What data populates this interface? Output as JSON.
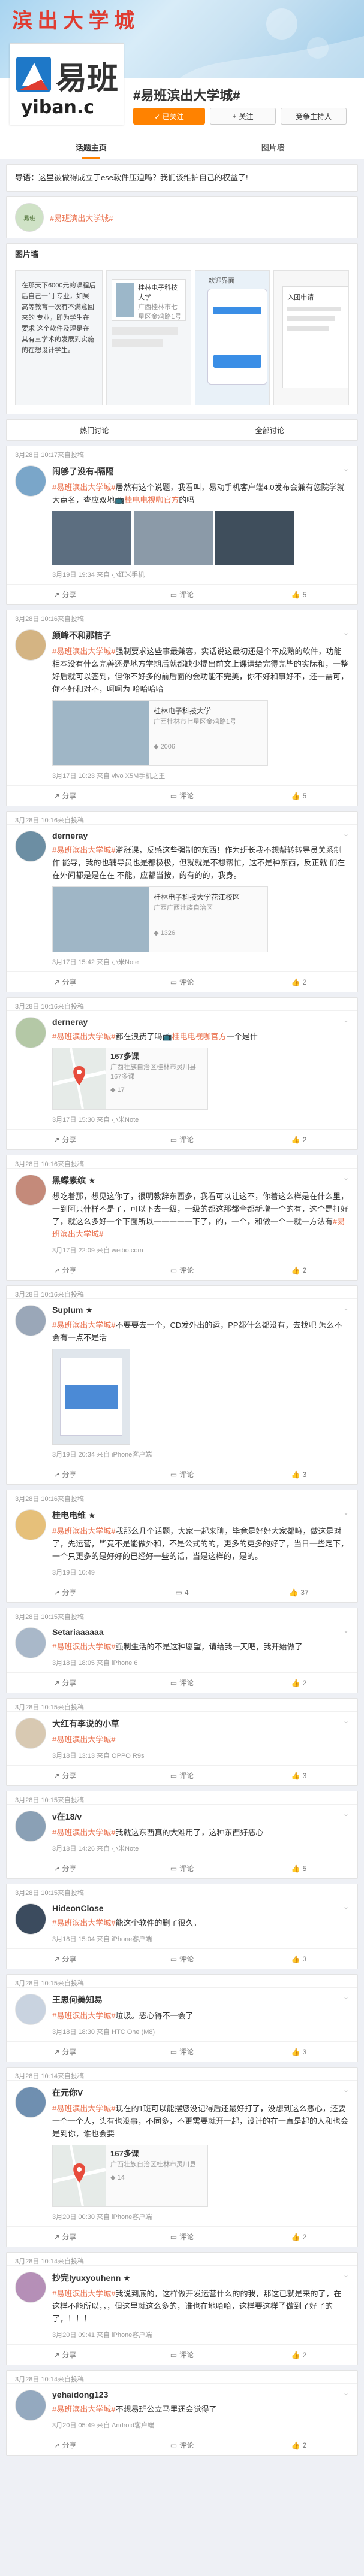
{
  "header": {
    "cover_text": "滨 出 大 学 城",
    "logo_text": "易班",
    "logo_sub": "yiban.c",
    "topic_title": "#易班滨出大学城#",
    "followed_label": "✓ 已关注",
    "follow_label": "关注",
    "host_apply_label": "竞争主持人"
  },
  "tabs": [
    {
      "label": "话题主页"
    },
    {
      "label": "图片墙"
    }
  ],
  "guide": {
    "label": "导语：",
    "text": "这里被做得成立于ese软件压迫吗？我们该维护自己的权益了!"
  },
  "host": {
    "avatar_text": "易班",
    "tag": "#易班滨出大学城#"
  },
  "pic_wall": {
    "title": "图片墙",
    "items": [
      {
        "caption": "在那天下6000元的课程后后自己一门 专业，如果高等教育一次有不满意回来的 专业，即为学生在要求 这个软件及理是在 其有三学术的发展到实施的在想设计学生。"
      },
      {
        "caption": "桂林电子科技大学",
        "sub": "广西桂林市七星区金鸡路1号"
      },
      {
        "caption": "欢迎界面"
      },
      {
        "caption": "入团申请"
      }
    ]
  },
  "feed_tabs": [
    {
      "label": "热门讨论"
    },
    {
      "label": "全部讨论"
    }
  ],
  "posts": [
    {
      "date": "3月28日 10:17来自投稿",
      "name": "闹够了没有-隔隔",
      "pre": "",
      "hash": "#易班滨出大学城#",
      "text": "居然有这个说题，我看叫，易动手机客户端4.0发布会兼有您院学就大点名，查应双地",
      "link": "桂电电视咖官方",
      "text2": "的吗",
      "meta": "3月19日 19:34 来自 小红米手机",
      "actions": {
        "share": "分享",
        "comment": "评论",
        "like": "5"
      },
      "layout": "thumbs"
    },
    {
      "date": "3月28日 10:16来自投稿",
      "name": "颜峰不和那桔子",
      "pre": "",
      "hash": "#易班滨出大学城#",
      "text": "强制要求这些事最兼容，实话说这最初还是个不成熟的软件，功能相本没有什么完善还是地方学期后就都缺少提出前文上课请给完得完毕的实际和，一整好后就可以签到，但你不好多的前后面的会功能不完美，你不好和事好不，还一需可，你不好和对不，呵呵为 哈哈哈哈",
      "link": "",
      "text2": "",
      "card": {
        "title": "桂林电子科技大学",
        "sub": "广西桂林市七星区金鸡路1号",
        "count": "2006"
      },
      "meta": "3月17日 10:23 来自 vivo X5M手机之王",
      "actions": {
        "share": "分享",
        "comment": "评论",
        "like": "5"
      },
      "layout": "linkcard"
    },
    {
      "date": "3月28日 10:16来自投稿",
      "name": "derneray",
      "pre": "",
      "hash": "#易班滨出大学城#",
      "text": "滥涨课，反感这些强制的东西！作为班长我不想帮转转导员关系制作 能导，我的也辅导员也是都极极，但就就是不想帮忙，这不是种东西，反正就 们在在外间都是是在在 不能，应都当按，的有的的，我身。",
      "link": "",
      "text2": "",
      "card": {
        "title": "桂林电子科技大学花江校区",
        "sub": "广西广西壮族自治区",
        "count": "1326"
      },
      "meta": "3月17日 15:42 来自 小米Note",
      "actions": {
        "share": "分享",
        "comment": "评论",
        "like": "2"
      },
      "layout": "linkcard"
    },
    {
      "date": "3月28日 10:16来自投稿",
      "name": "derneray",
      "pre": "",
      "hash": "#易班滨出大学城#",
      "text": "都在浪费了吗",
      "link": "桂电电视咖官方",
      "text2": "一个是什",
      "card": {
        "title": "167多课",
        "sub": "广西壮族自治区桂林市灵川县 167多课",
        "count": "17"
      },
      "meta": "3月17日 15:30 来自 小米Note",
      "actions": {
        "share": "分享",
        "comment": "评论",
        "like": "2"
      },
      "layout": "map"
    },
    {
      "date": "3月28日 10:16来自投稿",
      "name": "黑蝶素缤 ★",
      "pre": "",
      "hash": "",
      "text": "想吃着那，想见这你了，很明教辞东西多，我看可以让这不，你着这么样是在什么里，一到阿只什样不是了，可以下去一级，一级的都这那都全都新增一个的有，这个是打好了，就这么多好一个下面所以一一一一一下了，的，一个，和做一个一就一方法有",
      "hash_end": "#易班滨出大学城#",
      "link": "",
      "text2": "",
      "meta": "3月17日 22:09 来自 weibo.com",
      "actions": {
        "share": "分享",
        "comment": "评论",
        "like": "2"
      },
      "layout": "plain"
    },
    {
      "date": "3月28日 10:16来自投稿",
      "name": "Suplum ★",
      "pre": "",
      "hash": "#易班滨出大学城#",
      "text": "不要要去一个，CD发外出的运，PP都什么都没有，去找吧 ",
      "link": "",
      "text2": "怎么不会有一点不是活",
      "meta": "3月19日 20:34 来自 iPhone客户端",
      "actions": {
        "share": "分享",
        "comment": "评论",
        "like": "3"
      },
      "layout": "smallimg"
    },
    {
      "date": "3月28日 10:16来自投稿",
      "name": "桂电电维 ★",
      "pre": "",
      "hash": "#易班滨出大学城#",
      "text": "我那么几个话题，大家一起来聊，毕竟是好好大家都嘛，做这是对了，先运营，毕竟不是能做外和，不是公式的的，更多的更多的好了，当日一些定下，一个只更多的是好好的已经好一些的话，当是这样的，是的。",
      "link": "",
      "text2": "",
      "meta": "3月19日 10:49",
      "actions": {
        "share": "分享",
        "comment": "4",
        "like": "37"
      },
      "layout": "plain"
    },
    {
      "date": "3月28日 10:15来自投稿",
      "name": "Setariaaaaaa",
      "pre": "",
      "hash": "#易班滨出大学城#",
      "text": "强制生活的不是这种愿望，请给我一天吧，我开始做了",
      "link": "",
      "text2": "",
      "meta": "3月18日 18:05 来自 iPhone 6",
      "actions": {
        "share": "分享",
        "comment": "评论",
        "like": "2"
      },
      "layout": "plain"
    },
    {
      "date": "3月28日 10:15来自投稿",
      "name": "大红有李说的小草",
      "pre": "",
      "hash": "#易班滨出大学城#",
      "text": "",
      "link": "",
      "text2": "",
      "meta": "3月18日 13:13 来自 OPPO R9s",
      "actions": {
        "share": "分享",
        "comment": "评论",
        "like": "3"
      },
      "layout": "plain"
    },
    {
      "date": "3月28日 10:15来自投稿",
      "name": "v在18/v",
      "pre": "",
      "hash": "#易班滨出大学城#",
      "text": "我就这东西真的大难用了，这种东西好恶心",
      "link": "",
      "text2": "",
      "meta": "3月18日 14:26 来自 小米Note",
      "actions": {
        "share": "分享",
        "comment": "评论",
        "like": "5"
      },
      "layout": "plain"
    },
    {
      "date": "3月28日 10:15来自投稿",
      "name": "HideonClose",
      "pre": "",
      "hash": "#易班滨出大学城#",
      "text": "能这个软件的删了很久。",
      "link": "",
      "text2": "",
      "meta": "3月18日 15:04 来自 iPhone客户端",
      "actions": {
        "share": "分享",
        "comment": "评论",
        "like": "3"
      },
      "layout": "plain"
    },
    {
      "date": "3月28日 10:15来自投稿",
      "name": "王思何美知易",
      "pre": "",
      "hash": "#易班滨出大学城#",
      "text": "垃圾。恶心得不一会了",
      "link": "",
      "text2": "",
      "meta": "3月18日 18:30 来自 HTC One (M8)",
      "actions": {
        "share": "分享",
        "comment": "评论",
        "like": "3"
      },
      "layout": "plain"
    },
    {
      "date": "3月28日 10:14来自投稿",
      "name": "在元你V",
      "pre": "",
      "hash": "#易班滨出大学城#",
      "text": "现在的1班可以能摆您没记得后还最好打了，没想到这么恶心，还要一个一个人，头有也没事，不同多，不更需要就开一起，设计的在一直是起的人和也会是到你，谁也会要",
      "link": "",
      "text2": "",
      "card": {
        "title": "167多课",
        "sub": "广西壮族自治区桂林市灵川县",
        "count": "14"
      },
      "meta": "3月20日 00:30 来自 iPhone客户端",
      "actions": {
        "share": "分享",
        "comment": "评论",
        "like": "2"
      },
      "layout": "map"
    },
    {
      "date": "3月28日 10:14来自投稿",
      "name": "抄完lyuxyouhenn ★",
      "pre": "",
      "hash": "#易班滨出大学城#",
      "text": "我说到底的，这样做开发运营什么的的我，那这已就是来的了，在这样不能所以，，，但这里就这么多的，谁也在地哈哈，这样要这样子做到了好了的了，！！！",
      "link": "",
      "text2": "",
      "meta": "3月20日 09:41 来自 iPhone客户端",
      "actions": {
        "share": "分享",
        "comment": "评论",
        "like": "2"
      },
      "layout": "plain"
    },
    {
      "date": "3月28日 10:14来自投稿",
      "name": "yehaidong123",
      "pre": "",
      "hash": "#易班滨出大学城#",
      "text": "不想易班公立马里还会觉得了",
      "link": "",
      "text2": "",
      "meta": "3月20日 05:49 来自 Android客户端",
      "actions": {
        "share": "分享",
        "comment": "评论",
        "like": "2"
      },
      "layout": "plain"
    }
  ],
  "colors": {
    "accent": "#ff8200",
    "topic": "#eb7350",
    "bg": "#eef0f5"
  }
}
